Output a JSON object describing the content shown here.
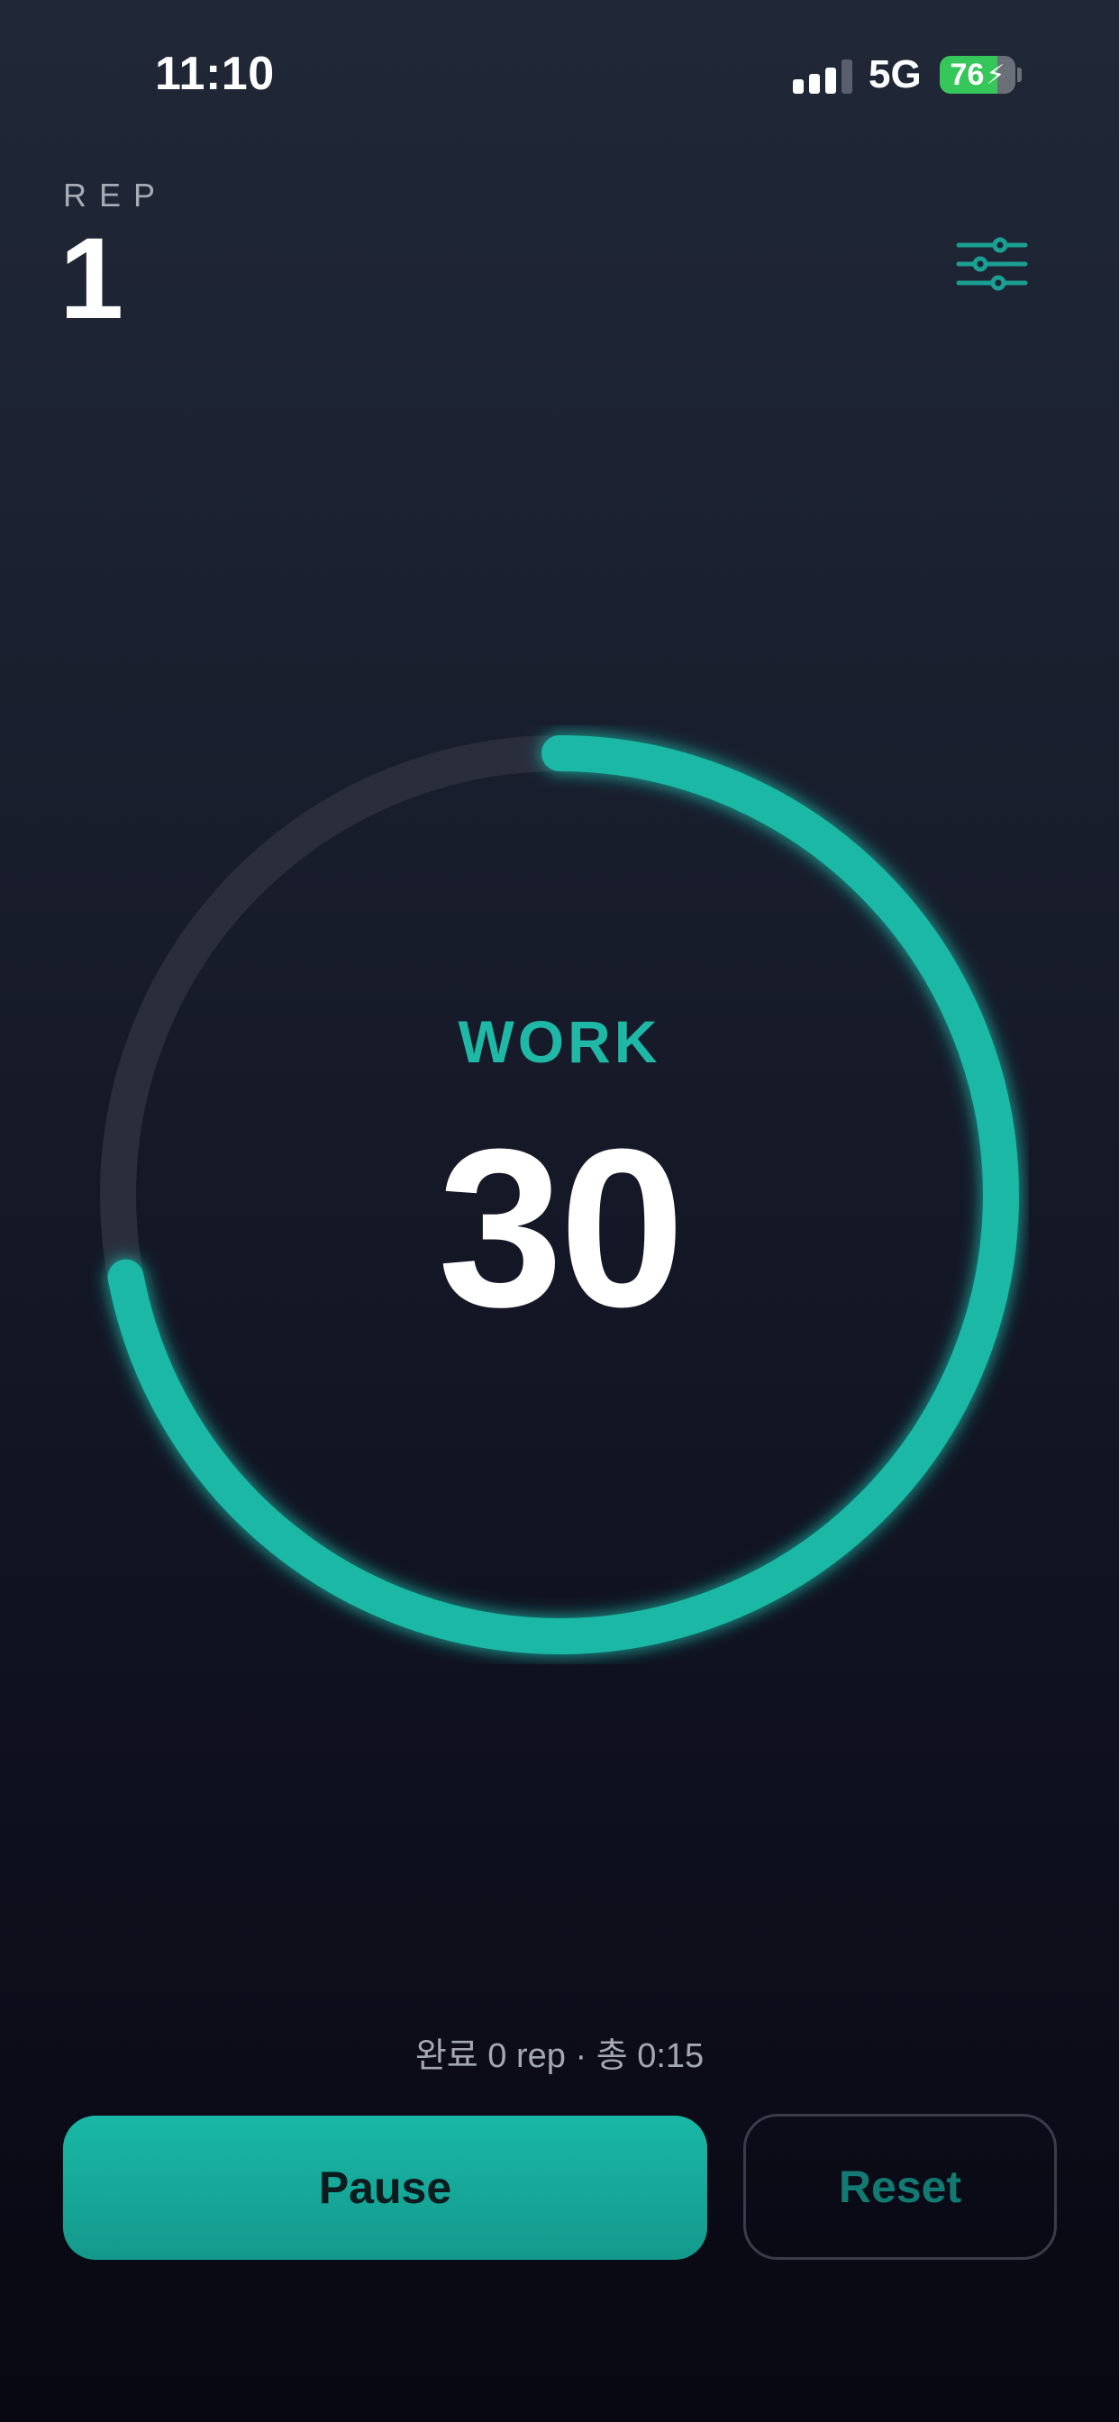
{
  "status_bar": {
    "time": "11:10",
    "network": "5G",
    "battery_level": "76",
    "battery_color": "#35c759"
  },
  "rep": {
    "label": "REP",
    "value": "1"
  },
  "settings": {
    "icon": "sliders-icon"
  },
  "timer": {
    "phase": "WORK",
    "remaining": "30",
    "progress_fraction": 0.72,
    "accent_color": "#1ab8a6",
    "track_color": "#2a2d3c"
  },
  "summary": {
    "text": "완료 0 rep · 총 0:15"
  },
  "controls": {
    "pause_label": "Pause",
    "reset_label": "Reset"
  }
}
